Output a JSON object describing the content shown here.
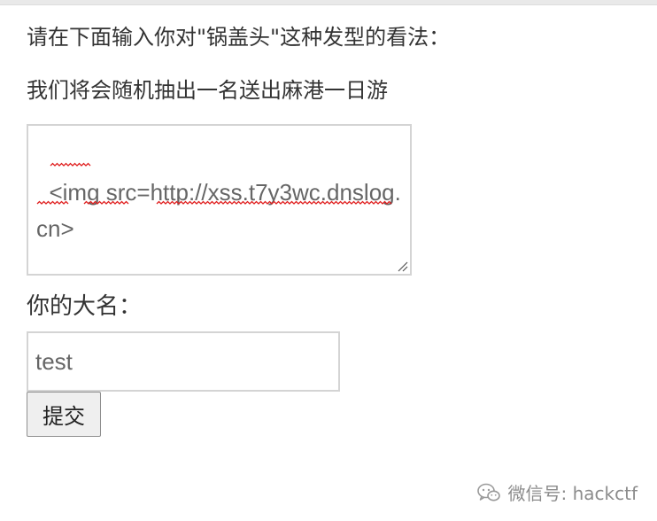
{
  "form": {
    "prompt_line_1": "请在下面输入你对\"锅盖头\"这种发型的看法：",
    "prompt_line_2": "我们将会随机抽出一名送出麻港一日游",
    "comment_value": "<img src=http://xss.t7y3wc.dnslog.cn>",
    "name_label": "你的大名：",
    "name_value": "test",
    "submit_label": "提交"
  },
  "watermark": {
    "icon": "wechat-icon",
    "text": "微信号: hackctf"
  },
  "colors": {
    "text": "#333333",
    "field_border": "#d4d4d4",
    "field_text": "#666666",
    "spellcheck_underline": "#e02020",
    "button_bg": "#efefef",
    "watermark": "#8c8c8c"
  }
}
